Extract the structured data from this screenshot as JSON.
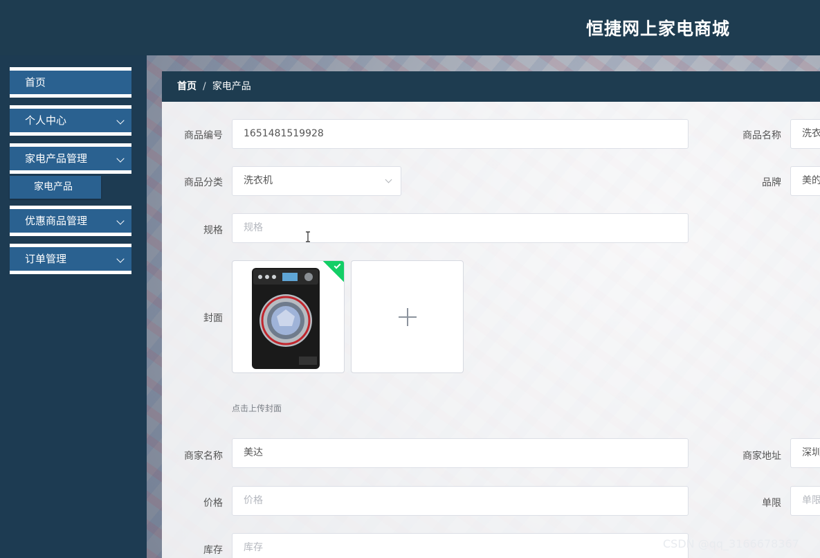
{
  "header": {
    "title": "恒捷网上家电商城"
  },
  "sidebar": {
    "items": [
      {
        "label": "首页"
      },
      {
        "label": "个人中心"
      },
      {
        "label": "家电产品管理"
      },
      {
        "label": "优惠商品管理"
      },
      {
        "label": "订单管理"
      }
    ],
    "sub_item": {
      "label": "家电产品"
    }
  },
  "breadcrumb": {
    "home": "首页",
    "separator": "/",
    "current": "家电产品"
  },
  "form": {
    "product_code": {
      "label": "商品编号",
      "value": "1651481519928"
    },
    "product_name": {
      "label": "商品名称",
      "value": "洗衣"
    },
    "category": {
      "label": "商品分类",
      "value": "洗衣机"
    },
    "brand": {
      "label": "品牌",
      "value": "美的"
    },
    "spec": {
      "label": "规格",
      "placeholder": "规格"
    },
    "cover": {
      "label": "封面",
      "hint": "点击上传封面"
    },
    "merchant_name": {
      "label": "商家名称",
      "value": "美达"
    },
    "merchant_address": {
      "label": "商家地址",
      "value": "深圳"
    },
    "price": {
      "label": "价格",
      "placeholder": "价格"
    },
    "limit": {
      "label": "单限",
      "placeholder": "单限"
    },
    "stock": {
      "label": "库存",
      "placeholder": "库存"
    }
  },
  "watermark": "CSDN @qq_3166678367",
  "colors": {
    "header_bg": "#1e3c50",
    "menu_bg": "#2a6190",
    "success": "#13ce66"
  },
  "icons": [
    "chevron-down-icon",
    "select-arrow-icon",
    "check-icon",
    "plus-icon",
    "text-cursor-icon"
  ]
}
